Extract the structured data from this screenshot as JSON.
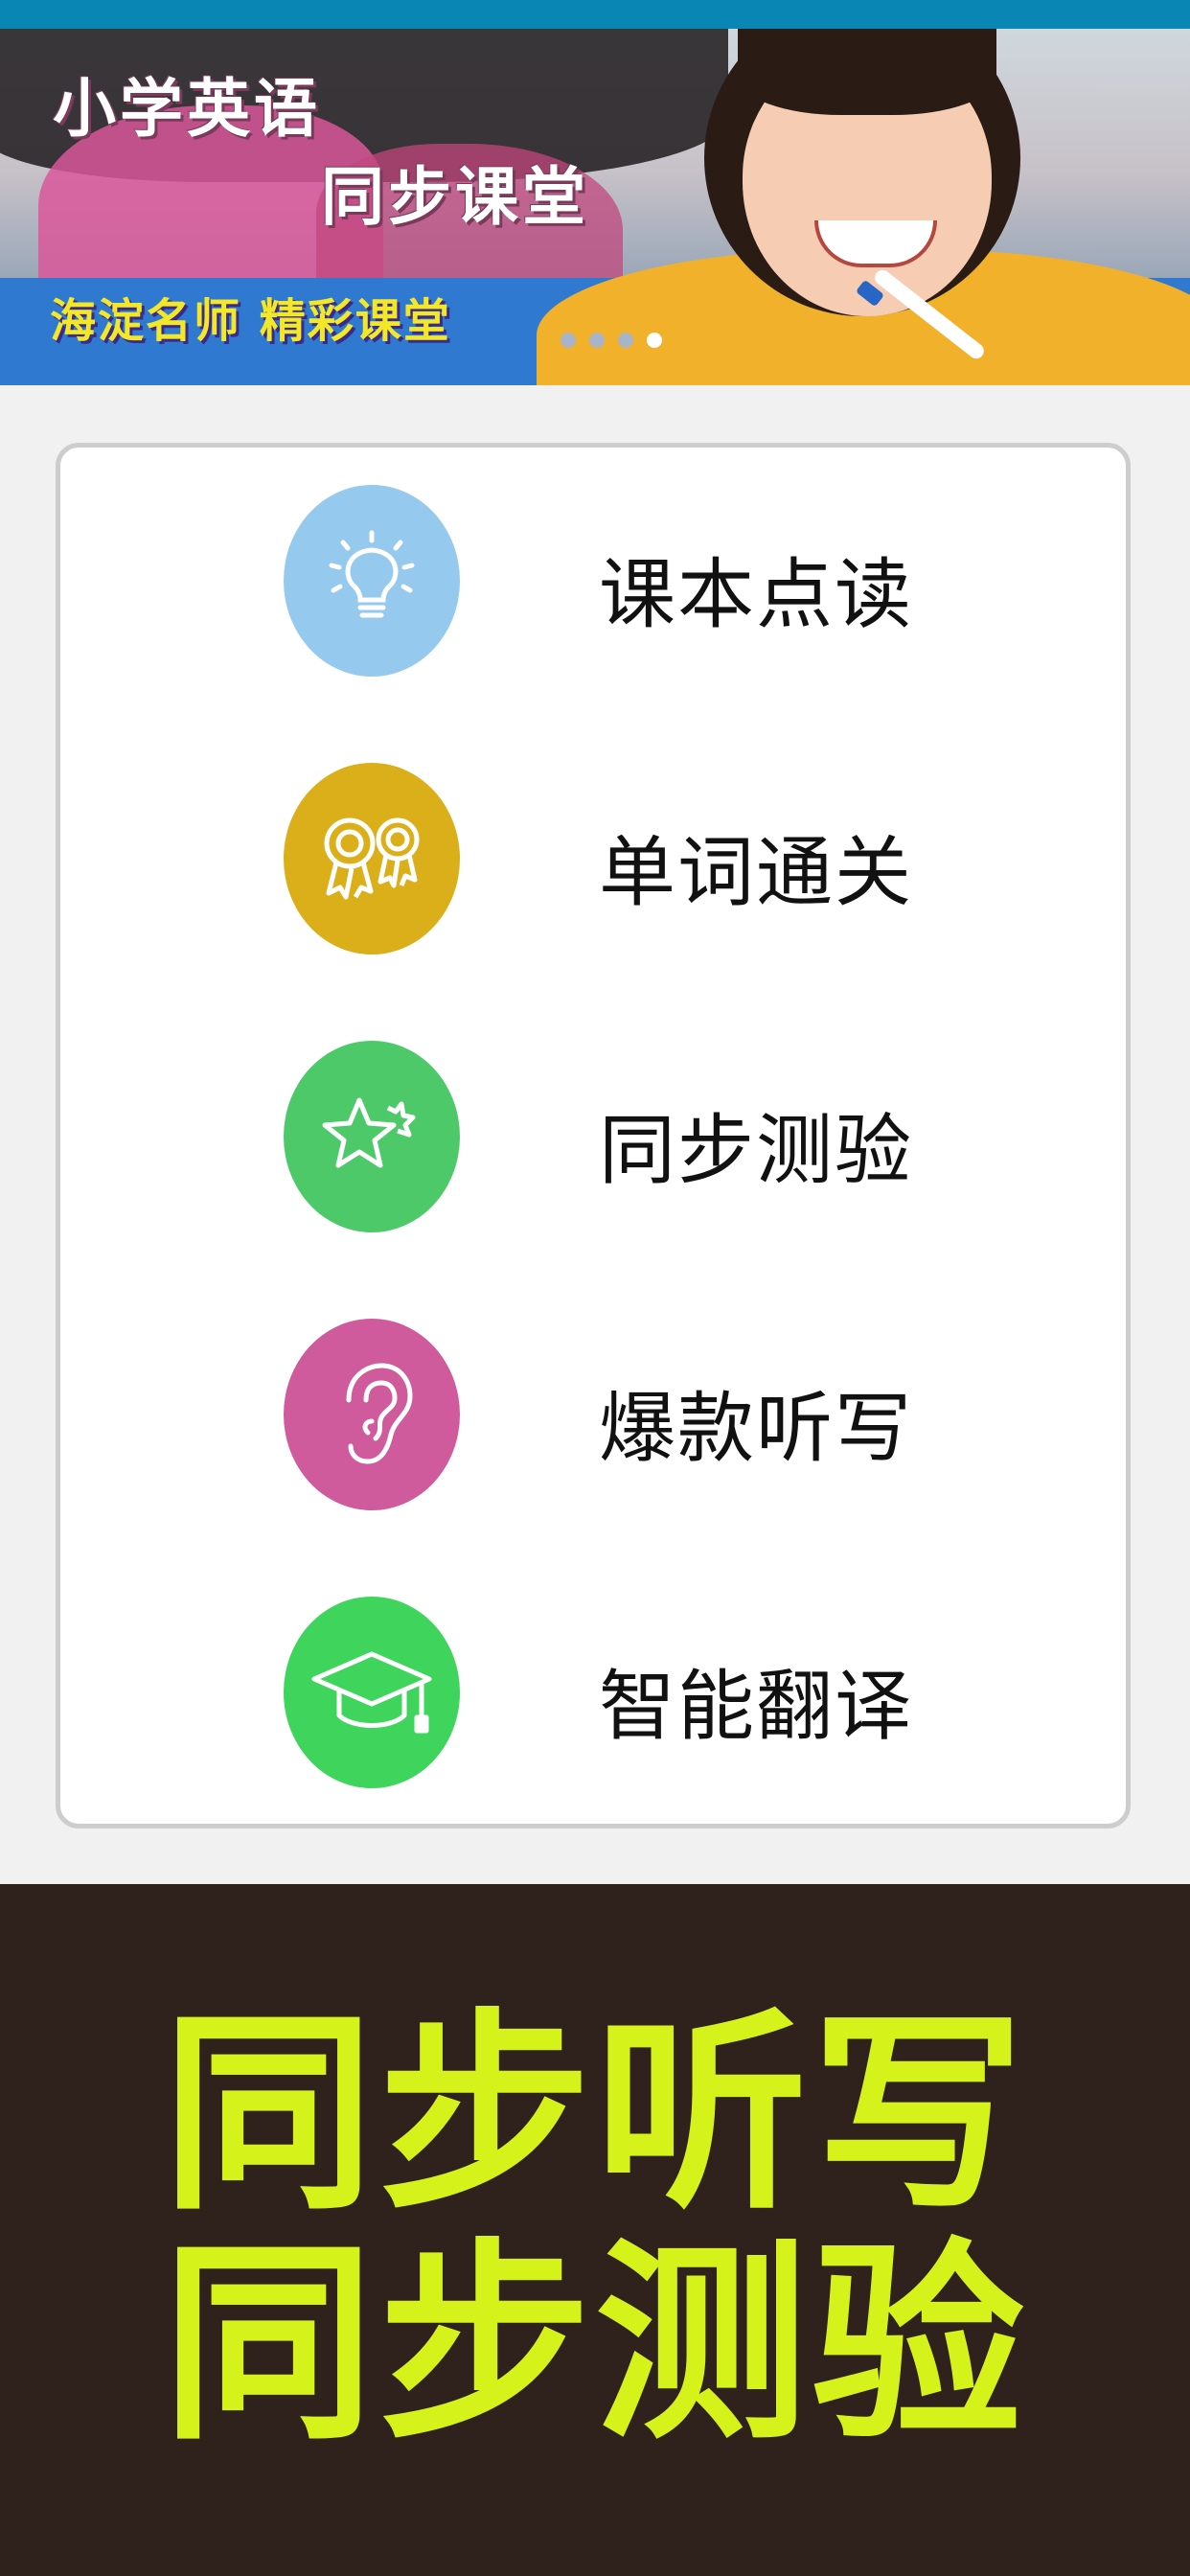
{
  "banner": {
    "title_line1": "小学英语",
    "title_line2": "同步课堂",
    "subtitle": "海淀名师 精彩课堂",
    "carousel_dots": 4,
    "active_dot": 3
  },
  "menu": {
    "items": [
      {
        "label": "课本点读",
        "icon": "lightbulb-icon",
        "color": "#95c9ee"
      },
      {
        "label": "单词通关",
        "icon": "award-medals-icon",
        "color": "#dbaf1a"
      },
      {
        "label": "同步测验",
        "icon": "stars-icon",
        "color": "#4ec96a"
      },
      {
        "label": "爆款听写",
        "icon": "ear-icon",
        "color": "#cf5a9c"
      },
      {
        "label": "智能翻译",
        "icon": "graduation-cap-icon",
        "color": "#3fd45c"
      }
    ]
  },
  "promo": {
    "line1": "同步听写",
    "line2": "同步测验"
  },
  "colors": {
    "top_bar": "#0a86b5",
    "promo_bg": "#2f221c",
    "promo_text": "#d6f21b"
  }
}
